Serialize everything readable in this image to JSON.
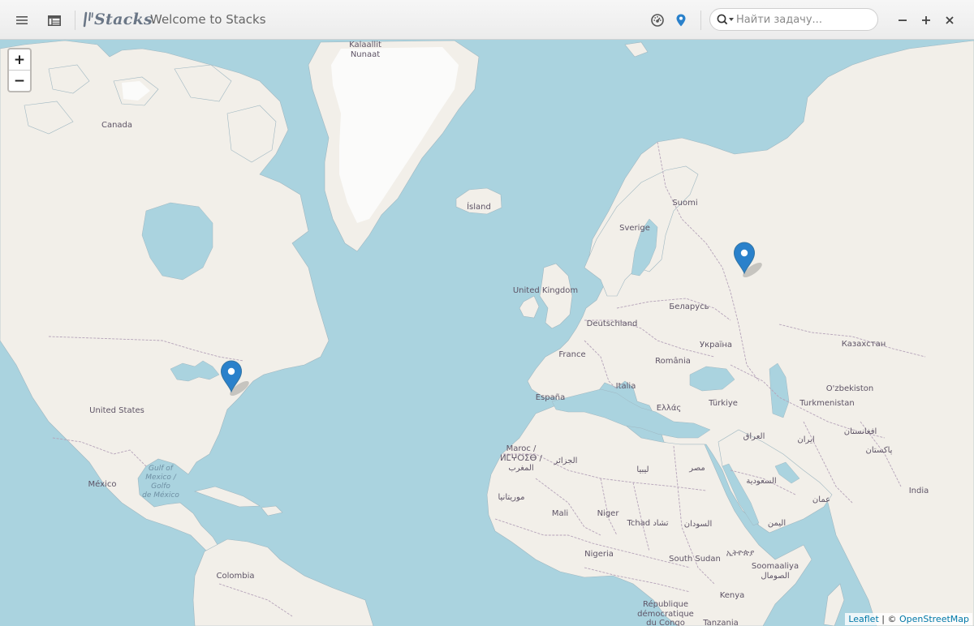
{
  "titlebar": {
    "app_name": "Stacks",
    "title": "Welcome to Stacks",
    "search": {
      "placeholder": "Найти задачу...",
      "value": ""
    },
    "icons": [
      "menu-icon",
      "table-icon",
      "dashboard-icon",
      "map-pin-icon",
      "search-icon",
      "minimize-icon",
      "maximize-icon",
      "close-icon"
    ]
  },
  "map": {
    "zoom_in_label": "+",
    "zoom_out_label": "−",
    "attribution": {
      "leaflet": "Leaflet",
      "separator": " | © ",
      "osm": "OpenStreetMap"
    },
    "markers": [
      {
        "name": "marker-new-york",
        "lat": 40.7,
        "lon": -74.0
      },
      {
        "name": "marker-moscow",
        "lat": 55.75,
        "lon": 37.6
      }
    ],
    "labels": {
      "kalaallit_1": "Kalaallit",
      "kalaallit_2": "Nunaat",
      "canada": "Canada",
      "island": "Ísland",
      "suomi": "Suomi",
      "sverige": "Sverige",
      "united_kingdom": "United Kingdom",
      "belarus": "Беларусь",
      "deutschland": "Deutschland",
      "france": "France",
      "ukraina": "Україна",
      "romania": "România",
      "kazakhstan": "Казахстан",
      "uzbekistan": "O'zbekiston",
      "turkmenistan": "Turkmenistan",
      "espana": "España",
      "italia": "Italia",
      "ellas": "Ελλάς",
      "turkiye": "Türkiye",
      "iraq": "العراق",
      "iran": "ایران",
      "afghanistan": "افغانستان",
      "pakistan": "پاکستان",
      "united_states": "United States",
      "mexico": "México",
      "gulf_1": "Gulf of",
      "gulf_2": "Mexico /",
      "gulf_3": "Golfo",
      "gulf_4": "de México",
      "maroc_1": "Maroc /",
      "maroc_2": "ⵍⵎⵖⵔⵉⴱ /",
      "maroc_3": "المغرب",
      "jazair": "الجزائر",
      "libya": "ليبيا",
      "misr": "مصر",
      "saudi": "السعودية",
      "mauritania": "موريتانيا",
      "mali": "Mali",
      "niger": "Niger",
      "tchad": "Tchad تشاد",
      "sudan": "السودان",
      "oman": "عمان",
      "yemen": "اليمن",
      "india": "India",
      "nigeria": "Nigeria",
      "south_sudan": "South Sudan",
      "ethiopia": "ኢትዮጵያ",
      "somaliya_1": "Soomaaliya",
      "somaliya_2": "الصومال",
      "colombia": "Colombia",
      "rdc_1": "République",
      "rdc_2": "démocratique",
      "rdc_3": "du Congo",
      "kenya": "Kenya",
      "tanzania": "Tanzania"
    }
  },
  "colors": {
    "ocean": "#aad3df",
    "land": "#f2efe9",
    "ice": "#fbfbfa",
    "border": "#b5a3b9",
    "label": "#5e5466",
    "marker": "#2a81cb",
    "marker_dark": "#3274a3"
  }
}
